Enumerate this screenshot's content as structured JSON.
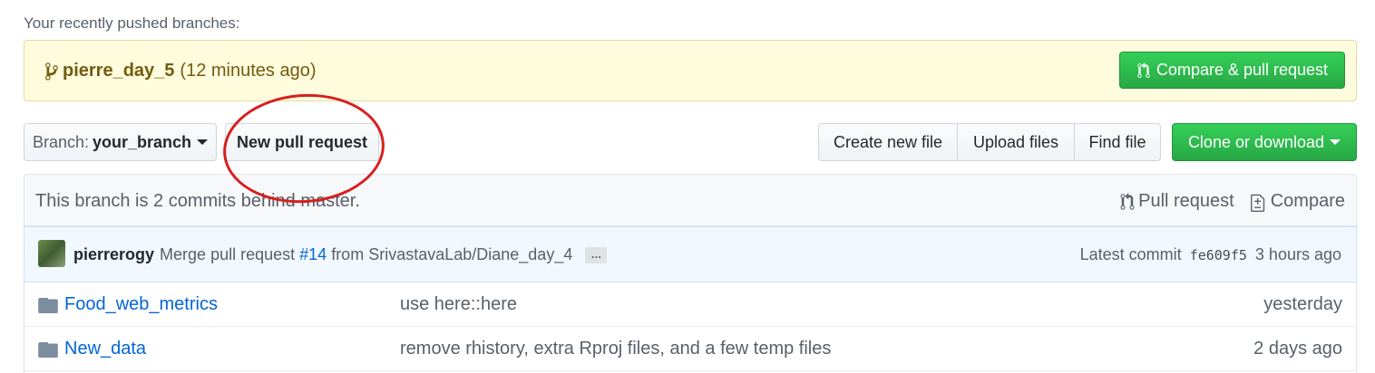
{
  "recent": {
    "title": "Your recently pushed branches:",
    "branch": "pierre_day_5",
    "ago": "(12 minutes ago)",
    "compare_button": "Compare & pull request"
  },
  "toolbar": {
    "branch_label": "Branch:",
    "branch_value": "your_branch",
    "new_pr": "New pull request",
    "create_file": "Create new file",
    "upload_files": "Upload files",
    "find_file": "Find file",
    "clone": "Clone or download"
  },
  "info": {
    "text": "This branch is 2 commits behind master.",
    "pull_request": "Pull request",
    "compare": "Compare"
  },
  "commit": {
    "author": "pierrerogy",
    "msg_before": "Merge pull request",
    "pr_number": "#14",
    "msg_after": "from SrivastavaLab/Diane_day_4",
    "ellipsis": "…",
    "latest_label": "Latest commit",
    "sha": "fe609f5",
    "time": "3 hours ago"
  },
  "files": [
    {
      "name": "Food_web_metrics",
      "message": "use here::here",
      "age": "yesterday"
    },
    {
      "name": "New_data",
      "message": "remove rhistory, extra Rproj files, and a few temp files",
      "age": "2 days ago"
    }
  ],
  "colors": {
    "link": "#0366d6",
    "green": "#28a745",
    "annotation": "#d81e1e",
    "banner": "#fffbdd"
  },
  "icons": [
    "git-branch-icon",
    "pull-request-icon",
    "file-diff-icon",
    "folder-icon",
    "caret-down-icon"
  ]
}
